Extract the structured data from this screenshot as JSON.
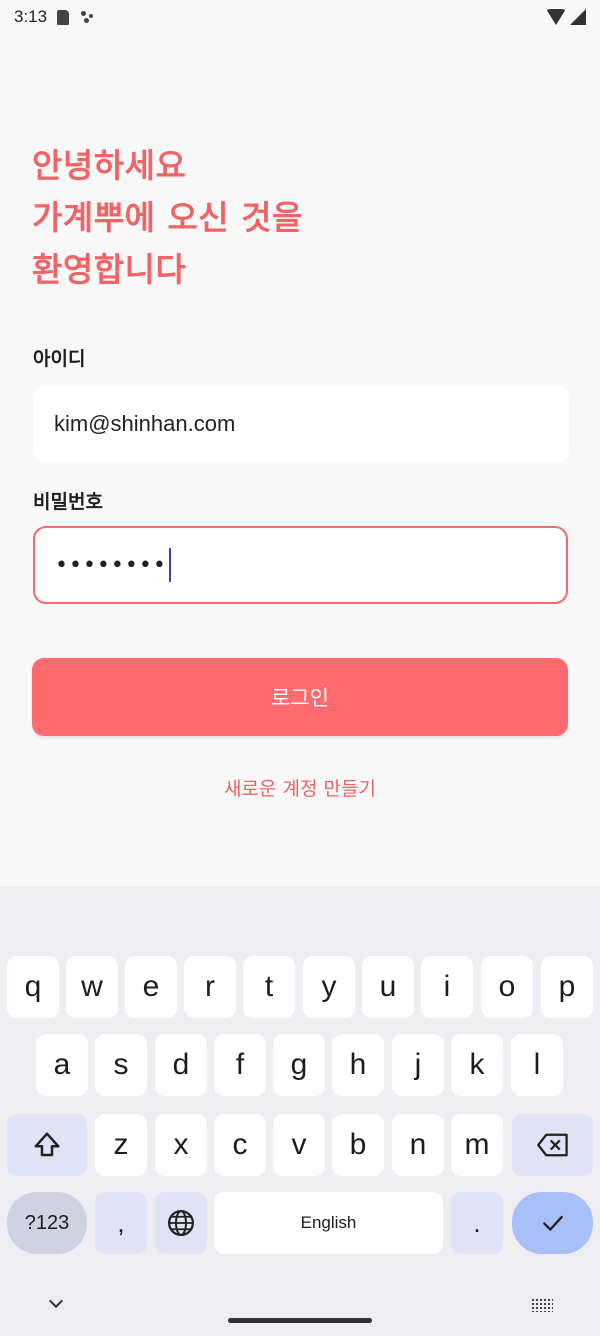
{
  "status_bar": {
    "time": "3:13"
  },
  "greeting": {
    "line1": "안녕하세요",
    "line2": "가계뿌에 오신 것을",
    "line3": "환영합니다"
  },
  "form": {
    "id_label": "아이디",
    "id_value": "kim@shinhan.com",
    "pw_label": "비밀번호",
    "pw_value": "••••••••"
  },
  "login_button": "로그인",
  "signup_link": "새로운 계정 만들기",
  "keyboard": {
    "row1": [
      "q",
      "w",
      "e",
      "r",
      "t",
      "y",
      "u",
      "i",
      "o",
      "p"
    ],
    "row2": [
      "a",
      "s",
      "d",
      "f",
      "g",
      "h",
      "j",
      "k",
      "l"
    ],
    "row3": [
      "z",
      "x",
      "c",
      "v",
      "b",
      "n",
      "m"
    ],
    "sym_label": "?123",
    "comma": ",",
    "space_label": "English",
    "period": "."
  },
  "colors": {
    "accent": "#ff6b6e",
    "text_accent": "#f06468"
  },
  "icons": [
    "sd-card-icon",
    "assistant-dots-icon",
    "wifi-icon",
    "signal-icon",
    "shift-icon",
    "backspace-icon",
    "globe-icon",
    "check-icon",
    "chevron-down-icon",
    "keyboard-icon"
  ]
}
